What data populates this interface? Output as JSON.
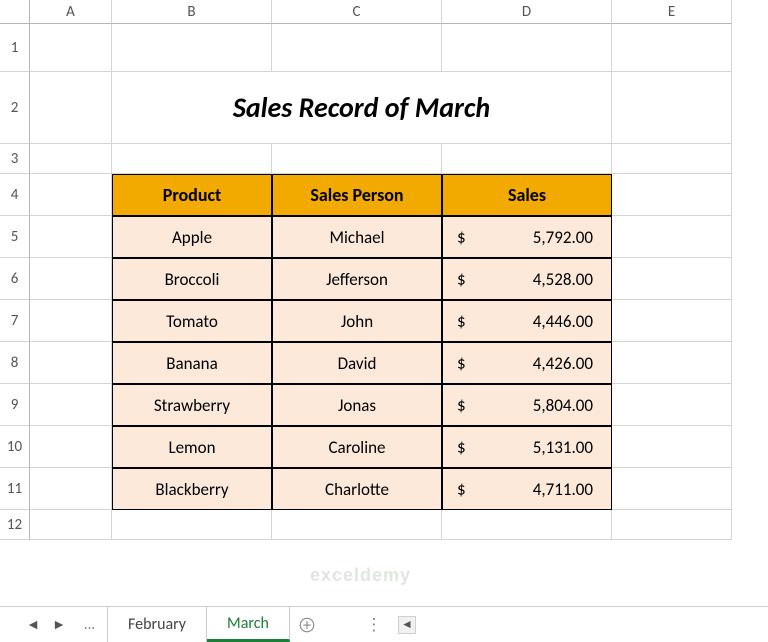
{
  "columns": [
    "A",
    "B",
    "C",
    "D",
    "E"
  ],
  "rows": [
    "1",
    "2",
    "3",
    "4",
    "5",
    "6",
    "7",
    "8",
    "9",
    "10",
    "11",
    "12"
  ],
  "title": "Sales Record of March",
  "table": {
    "headers": [
      "Product",
      "Sales Person",
      "Sales"
    ],
    "data": [
      {
        "product": "Apple",
        "person": "Michael",
        "currency": "$",
        "amount": "5,792.00"
      },
      {
        "product": "Broccoli",
        "person": "Jefferson",
        "currency": "$",
        "amount": "4,528.00"
      },
      {
        "product": "Tomato",
        "person": "John",
        "currency": "$",
        "amount": "4,446.00"
      },
      {
        "product": "Banana",
        "person": "David",
        "currency": "$",
        "amount": "4,426.00"
      },
      {
        "product": "Strawberry",
        "person": "Jonas",
        "currency": "$",
        "amount": "5,804.00"
      },
      {
        "product": "Lemon",
        "person": "Caroline",
        "currency": "$",
        "amount": "5,131.00"
      },
      {
        "product": "Blackberry",
        "person": "Charlotte",
        "currency": "$",
        "amount": "4,711.00"
      }
    ]
  },
  "tabbar": {
    "ellipsis": "...",
    "tabs": [
      {
        "label": "February",
        "active": false
      },
      {
        "label": "March",
        "active": true
      }
    ]
  },
  "colors": {
    "header_bg": "#f2a900",
    "cell_bg": "#fce9da",
    "active_tab": "#1a7f37"
  },
  "watermark": "exceldemy"
}
